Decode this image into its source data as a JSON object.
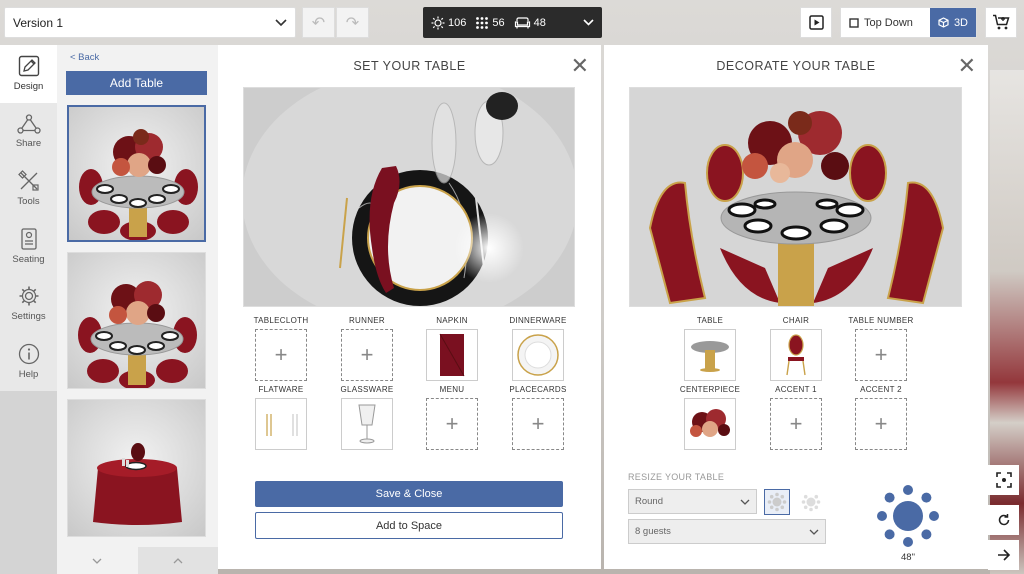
{
  "topbar": {
    "version_label": "Version 1",
    "counts": {
      "lights": "106",
      "seats": "56",
      "sofas": "48"
    },
    "view_options": {
      "top_down": "Top Down",
      "three_d": "3D"
    }
  },
  "tools": [
    {
      "label": "Design",
      "icon": "pencil-icon",
      "active": true
    },
    {
      "label": "Share",
      "icon": "share-icon"
    },
    {
      "label": "Tools",
      "icon": "tools-icon"
    },
    {
      "label": "Seating",
      "icon": "seating-icon"
    },
    {
      "label": "Settings",
      "icon": "gear-icon"
    },
    {
      "label": "Help",
      "icon": "info-icon"
    }
  ],
  "thumb_panel": {
    "back_label": "< Back",
    "add_table_label": "Add Table"
  },
  "set_panel": {
    "title": "SET YOUR TABLE",
    "items": [
      {
        "label": "TABLECLOTH",
        "filled": false
      },
      {
        "label": "RUNNER",
        "filled": false
      },
      {
        "label": "NAPKIN",
        "filled": true
      },
      {
        "label": "DINNERWARE",
        "filled": true
      },
      {
        "label": "FLATWARE",
        "filled": true
      },
      {
        "label": "GLASSWARE",
        "filled": true
      },
      {
        "label": "MENU",
        "filled": false
      },
      {
        "label": "PLACECARDS",
        "filled": false
      }
    ],
    "save_close_label": "Save & Close",
    "add_to_space_label": "Add to Space"
  },
  "decorate_panel": {
    "title": "DECORATE YOUR TABLE",
    "items": [
      {
        "label": "TABLE",
        "filled": true
      },
      {
        "label": "CHAIR",
        "filled": true
      },
      {
        "label": "TABLE NUMBER",
        "filled": false
      },
      {
        "label": "CENTERPIECE",
        "filled": true
      },
      {
        "label": "ACCENT 1",
        "filled": false
      },
      {
        "label": "ACCENT 2",
        "filled": false
      }
    ]
  },
  "resize": {
    "title": "RESIZE YOUR TABLE",
    "shape": "Round",
    "guests": "8 guests",
    "size": "48\""
  },
  "colors": {
    "accent": "#4a6aa5",
    "velvet": "#8a1420",
    "gold": "#c9a24a"
  }
}
